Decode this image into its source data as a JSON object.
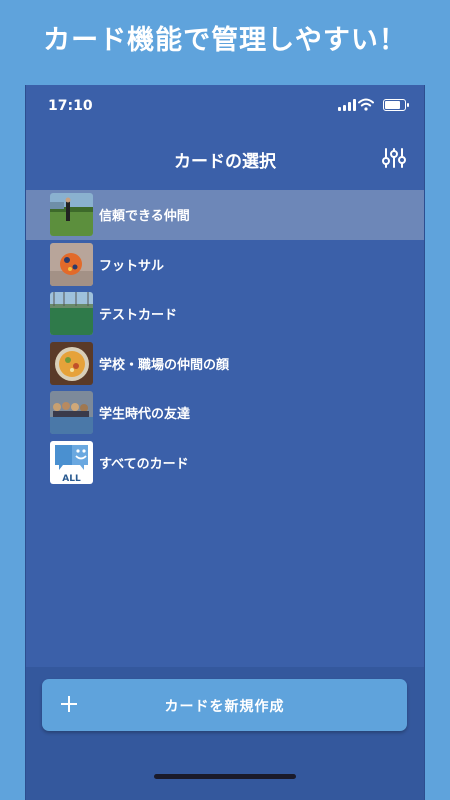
{
  "headline": "カード機能で管理しやすい！",
  "status_bar": {
    "time": "17:10"
  },
  "navbar": {
    "title": "カードの選択",
    "filter_icon": "sliders-icon"
  },
  "cards": [
    {
      "label": "信頼できる仲間",
      "selected": true
    },
    {
      "label": "フットサル",
      "selected": false
    },
    {
      "label": "テストカード",
      "selected": false
    },
    {
      "label": "学校・職場の仲間の顔",
      "selected": false
    },
    {
      "label": "学生時代の友達",
      "selected": false
    },
    {
      "label": "すべてのカード",
      "selected": false
    }
  ],
  "all_badge_text": "ALL",
  "create_button": {
    "label": "カードを新規作成",
    "icon": "plus-icon"
  },
  "colors": {
    "background": "#5fa3dc",
    "screen": "#3b60a9",
    "selected_row": "#6d87b8",
    "button": "#5fa3dc"
  }
}
